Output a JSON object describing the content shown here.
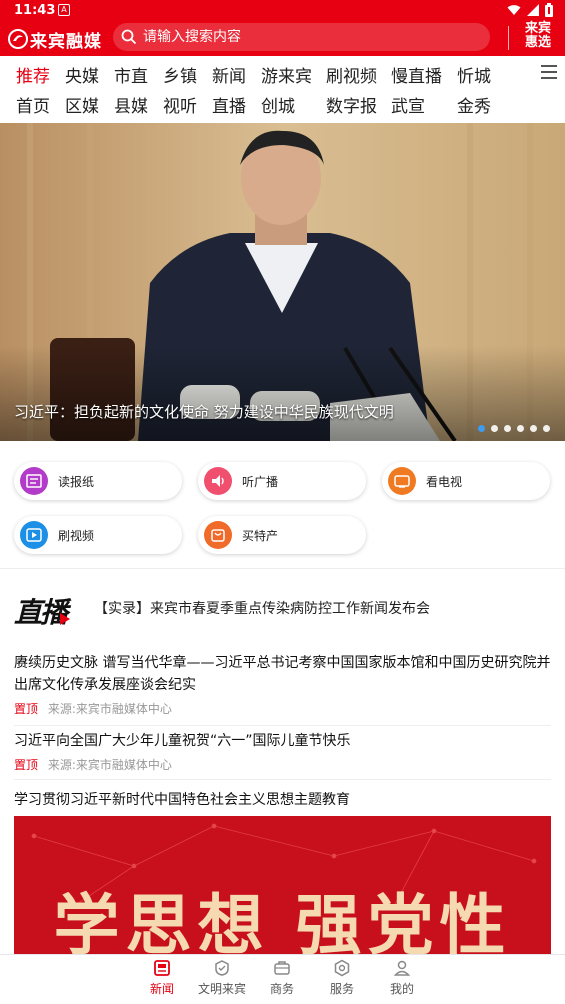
{
  "status": {
    "time": "11:43",
    "app_icon": "A"
  },
  "header": {
    "logo_text": "来宾融媒",
    "search_placeholder": "请输入搜索内容",
    "region_label": "来宾\n惠选"
  },
  "channels": {
    "row1": [
      "推荐",
      "央媒",
      "市直",
      "乡镇",
      "新闻",
      "游来宾",
      "刷视频",
      "慢直播",
      "忻城"
    ],
    "row2": [
      "首页",
      "区媒",
      "县媒",
      "视听",
      "直播",
      "创城",
      "数字报",
      "武宣",
      "金秀"
    ],
    "active": "推荐"
  },
  "banner": {
    "caption": "习近平：担负起新的文化使命 努力建设中华民族现代文明",
    "slide_count": 6,
    "active_slide": 1
  },
  "quick_entries": [
    {
      "label": "读报纸",
      "icon": "newspaper-icon",
      "color": "#b23cc9"
    },
    {
      "label": "听广播",
      "icon": "radio-icon",
      "color": "#f0506e"
    },
    {
      "label": "看电视",
      "icon": "tv-icon",
      "color": "#f07a22"
    },
    {
      "label": "刷视频",
      "icon": "video-icon",
      "color": "#1c8fe6"
    },
    {
      "label": "买特产",
      "icon": "shopping-icon",
      "color": "#f06a2a"
    }
  ],
  "live": {
    "logo_text": "直播",
    "title": "【实录】来宾市春夏季重点传染病防控工作新闻发布会"
  },
  "news": [
    {
      "title": "赓续历史文脉 谱写当代华章——习近平总书记考察中国国家版本馆和中国历史研究院并出席文化传承发展座谈会纪实",
      "tag": "置顶",
      "source": "来源:来宾市融媒体中心"
    },
    {
      "title": "习近平向全国广大少年儿童祝贺“六一”国际儿童节快乐",
      "tag": "置顶",
      "source": "来源:来宾市融媒体中心"
    }
  ],
  "topic": {
    "title": "学习贯彻习近平新时代中国特色社会主义思想主题教育",
    "banner_text_1": "学思想",
    "banner_text_2": "强党性"
  },
  "bottom_nav": [
    {
      "label": "新闻",
      "icon": "news-icon",
      "active": true
    },
    {
      "label": "文明来宾",
      "icon": "civilization-icon",
      "active": false
    },
    {
      "label": "商务",
      "icon": "briefcase-icon",
      "active": false
    },
    {
      "label": "服务",
      "icon": "service-icon",
      "active": false
    },
    {
      "label": "我的",
      "icon": "profile-icon",
      "active": false
    }
  ],
  "colors": {
    "brand_red": "#e60012"
  }
}
